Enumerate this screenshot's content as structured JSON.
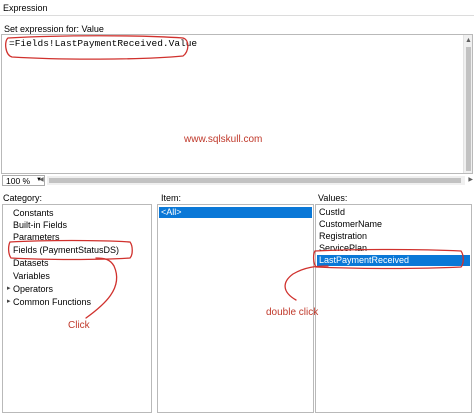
{
  "window": {
    "title": "Expression"
  },
  "set_expression_label": "Set expression for: Value",
  "editor": {
    "code": "=Fields!LastPaymentReceived.Value",
    "watermark": "www.sqlskull.com"
  },
  "zoom": {
    "value": "100 %"
  },
  "category": {
    "label": "Category:",
    "items": [
      {
        "label": "Constants",
        "expandable": false
      },
      {
        "label": "Built-in Fields",
        "expandable": false
      },
      {
        "label": "Parameters",
        "expandable": false
      },
      {
        "label": "Fields (PaymentStatusDS)",
        "expandable": false
      },
      {
        "label": "Datasets",
        "expandable": false
      },
      {
        "label": "Variables",
        "expandable": false
      },
      {
        "label": "Operators",
        "expandable": true
      },
      {
        "label": "Common Functions",
        "expandable": true
      }
    ]
  },
  "item": {
    "label": "Item:",
    "items": [
      {
        "label": "<All>",
        "selected": true
      }
    ]
  },
  "values": {
    "label": "Values:",
    "items": [
      {
        "label": "CustId",
        "selected": false
      },
      {
        "label": "CustomerName",
        "selected": false
      },
      {
        "label": "Registration",
        "selected": false
      },
      {
        "label": "ServicePlan",
        "selected": false
      },
      {
        "label": "LastPaymentReceived",
        "selected": true
      }
    ]
  },
  "annotations": {
    "click": "Click",
    "double_click": "double click",
    "color": "#c0392b"
  },
  "icons": {
    "expand": "expand-arrow-icon",
    "scroll_up": "scroll-up-icon",
    "dropdown": "chevron-down-icon"
  }
}
